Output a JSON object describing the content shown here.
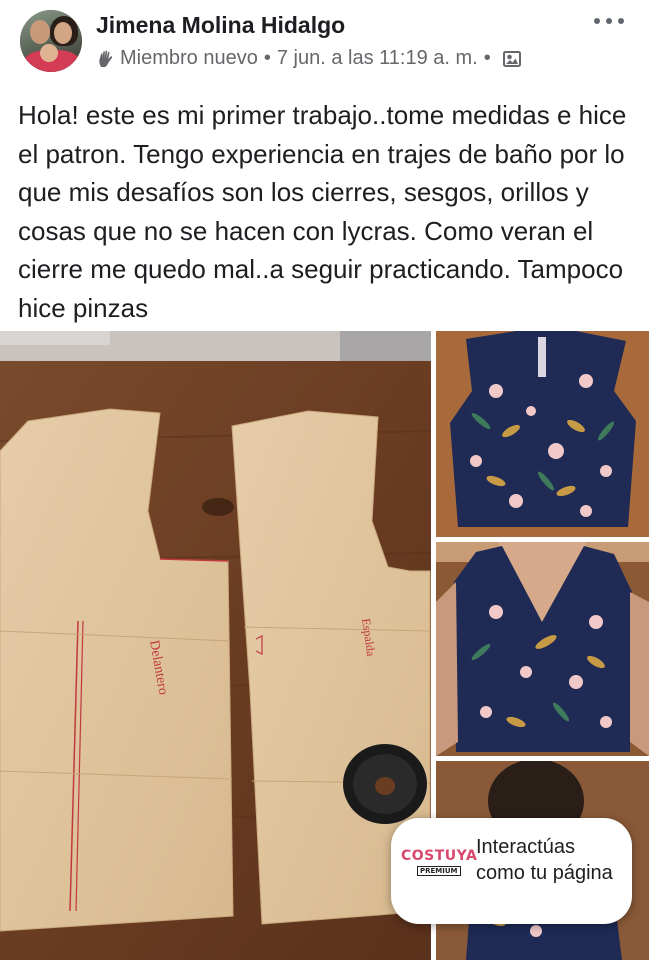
{
  "post": {
    "author": "Jimena Molina Hidalgo",
    "badge": "Miembro nuevo",
    "separator": "•",
    "timestamp": "7 jun. a las 11:19 a. m.",
    "visibility_icon": "group-photo-icon",
    "more_icon": "more-options-icon",
    "text": "Hola! este es mi primer trabajo..tome medidas e hice el patron. Tengo experiencia en trajes de baño por lo que mis desafíos son los cierres, sesgos, orillos y cosas que no se hacen con lycras. Como veran el cierre me quedo mal..a seguir practicando. Tampoco hice pinzas"
  },
  "photos": [
    {
      "name": "paper-pattern-photo",
      "label_left": "Delantero",
      "label_right": "Espalda"
    },
    {
      "name": "blouse-back-zipper-photo"
    },
    {
      "name": "blouse-front-worn-photo"
    },
    {
      "name": "blouse-back-worn-photo"
    }
  ],
  "toast": {
    "brand": "COSTUYA",
    "brand_sub": "PREMIUM",
    "message": "Interactúas como tu página"
  },
  "colors": {
    "text": "#1c1e21",
    "secondary": "#65676b",
    "brand_pink": "#d8486b",
    "blouse_navy": "#1f2a55"
  }
}
